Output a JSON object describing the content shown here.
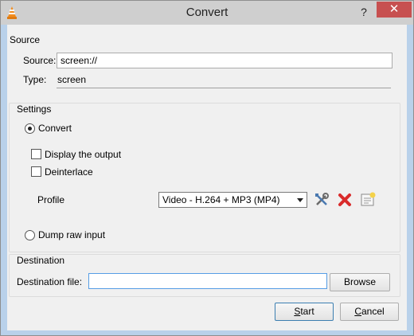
{
  "window": {
    "title": "Convert",
    "help_glyph": "?",
    "close_glyph": "✕"
  },
  "source": {
    "group_label": "Source",
    "source_label": "Source:",
    "source_value": "screen://",
    "type_label": "Type:",
    "type_value": "screen"
  },
  "settings": {
    "group_label": "Settings",
    "convert_label": "Convert",
    "convert_selected": true,
    "display_output_label": "Display the output",
    "display_output_checked": false,
    "deinterlace_label": "Deinterlace",
    "deinterlace_checked": false,
    "profile_label": "Profile",
    "profile_value": "Video - H.264 + MP3 (MP4)",
    "dump_raw_label": "Dump raw input",
    "dump_raw_selected": false
  },
  "destination": {
    "group_label": "Destination",
    "file_label": "Destination file:",
    "file_value": "",
    "browse_label": "Browse"
  },
  "buttons": {
    "start_accel": "S",
    "start_rest": "tart",
    "cancel_accel": "C",
    "cancel_rest": "ancel"
  },
  "icons": {
    "app": "vlc-cone-icon",
    "edit_profile": "wrench-screwdriver-icon",
    "delete_profile": "red-x-delete-icon",
    "new_profile": "new-profile-icon"
  },
  "colors": {
    "close_button": "#c75050",
    "focus_border": "#569de5",
    "delete_red": "#d92b2b"
  }
}
